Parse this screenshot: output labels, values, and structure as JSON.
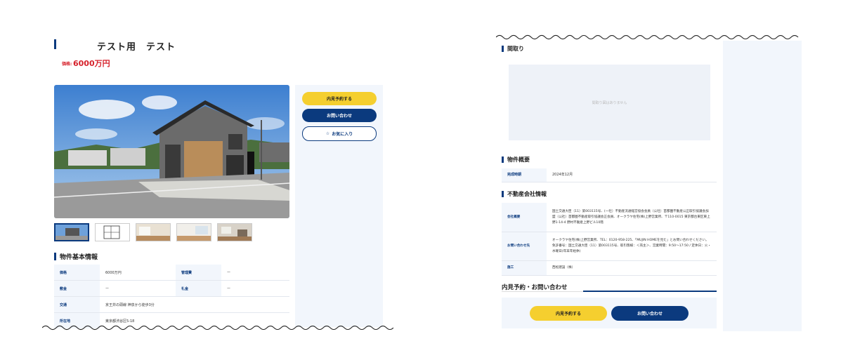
{
  "listing": {
    "title": "テスト用　テスト",
    "price_label": "価格:",
    "price_value": "6000万円"
  },
  "actions": {
    "visit_label": "内見予約する",
    "contact_label": "お問い合わせ",
    "favorite_label": "お気に入り",
    "favorite_icon": "☆"
  },
  "basic_info": {
    "heading": "物件基本情報",
    "rows": [
      {
        "k1": "価格",
        "v1": "6000万円",
        "k2": "管理費",
        "v2": "ー"
      },
      {
        "k1": "敷金",
        "v1": "ー",
        "k2": "礼金",
        "v2": "ー"
      }
    ],
    "traffic_key": "交通",
    "traffic_value": "京王井の頭線 神泉から徒歩3分",
    "address_key": "所在地",
    "address_value": "東京都渋谷区5-18"
  },
  "floorplan": {
    "heading": "間取り",
    "empty_text": "間取り図はありません"
  },
  "overview": {
    "heading": "物件概要",
    "completion_key": "完成時期",
    "completion_value": "2024年12月"
  },
  "company": {
    "heading": "不動産会社情報",
    "summary_key": "会社概要",
    "summary_value": "国土交通大臣（11）第003115号、(一社）不動産流通経営協会会員（公社）首都圏不動産公正取引協議会加盟（公社）首都圏不動産取引協議会正会員、オークラヤ住宅(株)上野営業所、〒110-0015 東京都台東区東上野1-14-4 野村不動産上野ビル10階",
    "contact_key": "お問い合わせ先",
    "contact_value": "オークラヤ住宅(株)上野営業所、TEL：0120-958-225、「MUJIN HOMEを見た」とお問い合わせください。免許番号：国土交通大臣（11）第003115号、取引態様：＜売主＞、営業時間：9:50〜17:50 / 定休日：火・水曜日(年末年始休)",
    "builder_key": "施工",
    "builder_value": "西松建設（株）"
  },
  "contact_section": {
    "heading": "内見予約・お問い合わせ",
    "visit_label": "内見予約する",
    "contact_label": "お問い合わせ"
  }
}
